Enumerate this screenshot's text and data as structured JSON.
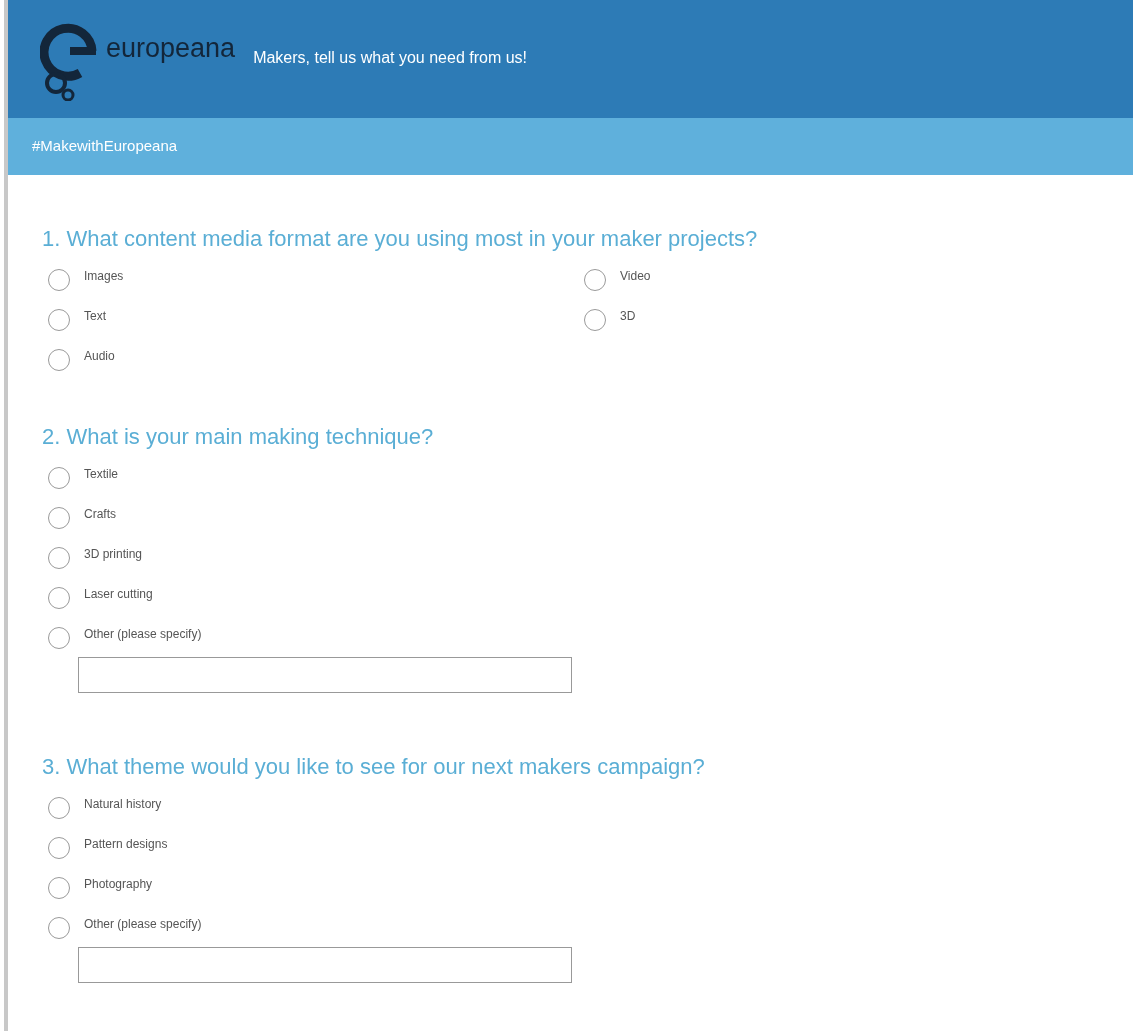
{
  "header": {
    "logo_text": "europeana",
    "tagline": "Makers, tell us what you need from us!"
  },
  "subheader": {
    "hashtag": "#MakewithEuropeana"
  },
  "questions": [
    {
      "title": "1. What content media format are you using most in your maker projects?",
      "columns": [
        [
          {
            "label": "Images",
            "selected": false,
            "kind": "choice"
          },
          {
            "label": "Text",
            "selected": false,
            "kind": "choice"
          },
          {
            "label": "Audio",
            "selected": false,
            "kind": "choice"
          }
        ],
        [
          {
            "label": "Video",
            "selected": false,
            "kind": "choice"
          },
          {
            "label": "3D",
            "selected": false,
            "kind": "choice"
          }
        ]
      ]
    },
    {
      "title": "2. What is your main making technique?",
      "columns": [
        [
          {
            "label": "Textile",
            "selected": false,
            "kind": "choice"
          },
          {
            "label": "Crafts",
            "selected": false,
            "kind": "choice"
          },
          {
            "label": "3D printing",
            "selected": false,
            "kind": "choice"
          },
          {
            "label": "Laser cutting",
            "selected": false,
            "kind": "choice"
          },
          {
            "label": "Other (please specify)",
            "selected": false,
            "kind": "other"
          }
        ]
      ]
    },
    {
      "title": "3. What theme would you like to see for our next makers campaign?",
      "columns": [
        [
          {
            "label": "Natural history",
            "selected": false,
            "kind": "choice"
          },
          {
            "label": "Pattern designs",
            "selected": false,
            "kind": "choice"
          },
          {
            "label": "Photography",
            "selected": false,
            "kind": "choice"
          },
          {
            "label": "Other (please specify)",
            "selected": false,
            "kind": "other"
          }
        ]
      ]
    }
  ]
}
